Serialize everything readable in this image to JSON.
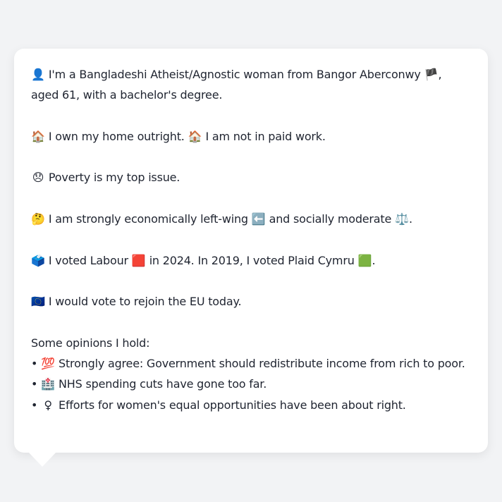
{
  "profile": {
    "intro": {
      "emoji": "👤",
      "text": "I'm a Bangladeshi Atheist/Agnostic woman from Bangor Aberconwy",
      "flag": "🏴",
      "tail": ", aged 61, with a bachelor's degree."
    },
    "housing": {
      "emoji1": "🏠",
      "text1": "I own my home outright.",
      "emoji2": "🏠",
      "text2": "I am not in paid work."
    },
    "issue": {
      "emoji": "😞",
      "text": "Poverty is my top issue."
    },
    "ideology": {
      "emoji": "🤔",
      "text1": "I am strongly economically left-wing",
      "emoji2": "⬅️",
      "text2": "and socially moderate",
      "emoji3": "⚖️",
      "end": "."
    },
    "votes": {
      "emoji": "🗳️",
      "text1": "I voted Labour",
      "labour_square": "🟥",
      "text2": "in 2024. In 2019, I voted Plaid Cymru",
      "plaid_square": "🟩",
      "end": "."
    },
    "eu": {
      "emoji": "🇪🇺",
      "text": "I would vote to rejoin the EU today."
    },
    "opinions_heading": "Some opinions I hold:",
    "opinions": [
      {
        "bullet": "•",
        "emoji": "💯",
        "text": "Strongly agree: Government should redistribute income from rich to poor."
      },
      {
        "bullet": "•",
        "emoji": "🏥",
        "text": "NHS spending cuts have gone too far."
      },
      {
        "bullet": "•",
        "emoji": "♀",
        "text": "Efforts for women's equal opportunities have been about right."
      }
    ]
  },
  "colors": {
    "background": "#f2f3f5",
    "card": "#ffffff",
    "text": "#1f2430"
  }
}
